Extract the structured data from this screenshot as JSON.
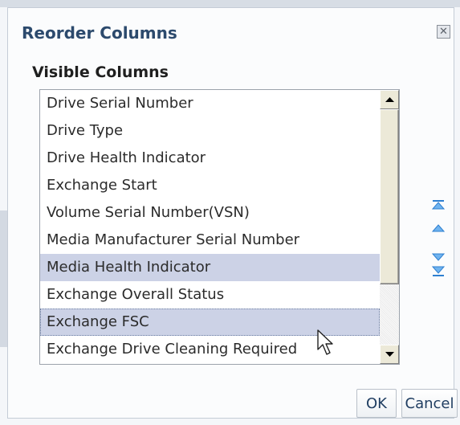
{
  "dialog": {
    "title": "Reorder Columns",
    "close_icon": "close-icon"
  },
  "visible_columns": {
    "label": "Visible Columns",
    "items": [
      "Drive Serial Number",
      "Drive Type",
      "Drive Health Indicator",
      "Exchange Start",
      "Volume Serial Number(VSN)",
      "Media Manufacturer Serial Number",
      "Media Health Indicator",
      "Exchange Overall Status",
      "Exchange FSC",
      "Exchange Drive Cleaning Required"
    ],
    "selected_items": [
      "Media Health Indicator",
      "Exchange FSC"
    ]
  },
  "move_controls": [
    "move-to-top-icon",
    "move-up-icon",
    "move-down-icon",
    "move-to-bottom-icon"
  ],
  "buttons": {
    "ok": "OK",
    "cancel": "Cancel"
  },
  "colors": {
    "title": "#2c4a6d",
    "selection": "#ccd2e6",
    "arrow_accent": "#3f8fd8"
  }
}
